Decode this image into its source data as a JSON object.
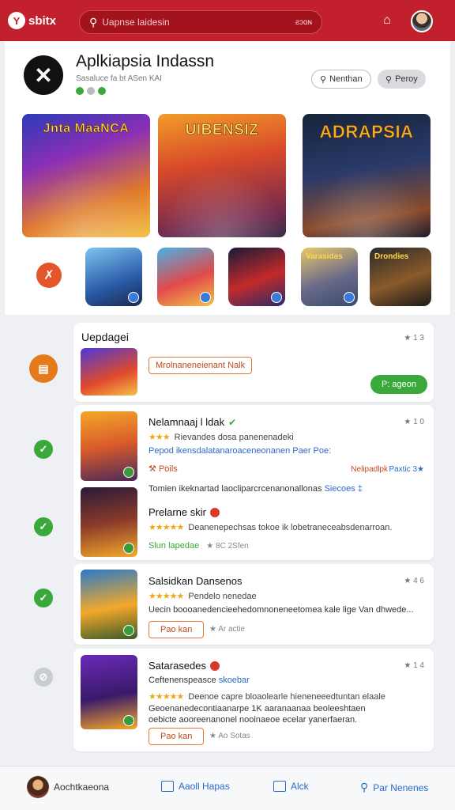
{
  "topbar": {
    "logo_glyph": "Y",
    "logo_text": "sbitx",
    "search_placeholder": "Uapnse laidesin",
    "search_right": "ƨɔɑɴ",
    "bell_icon": "home-icon",
    "avatar_icon": "user-avatar"
  },
  "app": {
    "logo_glyph": "✕",
    "title": "Aplkiapsia Indassn",
    "subtitle": "Sasaluce fa bt ASen KAI",
    "follow_label": "Nenthan",
    "report_label": "Peroy",
    "accent": "#c3202d"
  },
  "banners": [
    {
      "title": "Jnta MaaNCA"
    },
    {
      "title": "UIBENSIZ"
    },
    {
      "title": "ADRAPSIA"
    }
  ],
  "thumbs": [
    {
      "label": ""
    },
    {
      "label": ""
    },
    {
      "label": ""
    },
    {
      "label": "Varasidas"
    },
    {
      "label": "Drondies"
    }
  ],
  "update_section": {
    "heading": "Uepdagei",
    "meta": "★ 1 3",
    "tag_label": "Mrolnaneneienant Nalk",
    "action_label": "P: ageon"
  },
  "list": [
    {
      "name": "Nelamnaaj l ldak",
      "stars": "★★★",
      "line1": "Rievandes dosa panenenadeki",
      "line2": "Pepod ikensdalatanaroaceneonanen Paer Poe:",
      "line3_label": "Poils",
      "line3_right_a": "Nelipadlpk",
      "line3_right_b": "Paxtic 3★",
      "footer": "Tomien ikeknartad laocliparcrcenanonallonas",
      "footer_blue": "Siecoes ‡",
      "meta": "★ 1 0"
    },
    {
      "name": "Prelarne skir",
      "stars": "★★★★★",
      "line1": "Deanenepechsas tokoe ik lobetraneceabsdenarroan.",
      "tags_green": "Slun lapedae",
      "tags_grey": "★ 8C 2Sfen"
    },
    {
      "name": "Salsidkan Dansenos",
      "stars": "★★★★★",
      "line1": "Pendelo nenedae",
      "line2": "Uecin boooanedencieehedomnoneneetomea kale lige Van dhwede...",
      "button": "Pao kan",
      "note": "★ Ar actie",
      "meta": "★ 4 6"
    },
    {
      "name": "Satarasedes",
      "stars": "★★★★★",
      "line0": "Ceftenenspeasce",
      "line0_blue": "skoebar",
      "line1": "Deenoe capre bloaolearle hieneneeedtuntan elaale",
      "line2": "Geoenanedecontiaanarpe 1K aaranaanaa beoleeshtaen",
      "line3": "oebicte aooreenanonel nooinaeoe ecelar yanerfaeran.",
      "button": "Pao kan",
      "note": "★ Ao Sotas",
      "meta": "★ 1 4"
    }
  ],
  "bottom_nav": {
    "profile": "Aochtkaeona",
    "item1": "Aaoll Hapas",
    "item2": "Alck",
    "item3": "Par Nenenes"
  }
}
